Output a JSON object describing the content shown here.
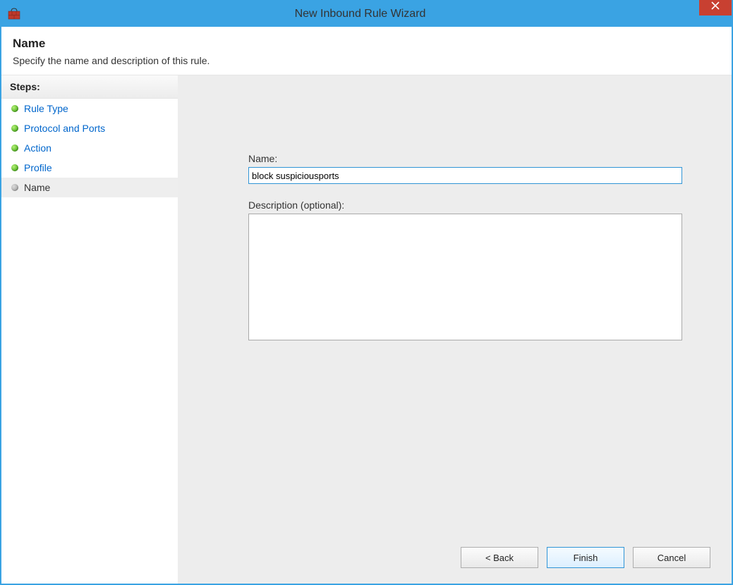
{
  "window": {
    "title": "New Inbound Rule Wizard",
    "close_glyph": "×"
  },
  "header": {
    "title": "Name",
    "subtitle": "Specify the name and description of this rule."
  },
  "sidebar": {
    "heading": "Steps:",
    "steps": [
      {
        "label": "Rule Type",
        "completed": true,
        "current": false
      },
      {
        "label": "Protocol and Ports",
        "completed": true,
        "current": false
      },
      {
        "label": "Action",
        "completed": true,
        "current": false
      },
      {
        "label": "Profile",
        "completed": true,
        "current": false
      },
      {
        "label": "Name",
        "completed": false,
        "current": true
      }
    ]
  },
  "form": {
    "name_label": "Name:",
    "name_value": "block suspiciousports",
    "description_label": "Description (optional):",
    "description_value": ""
  },
  "buttons": {
    "back": "< Back",
    "finish": "Finish",
    "cancel": "Cancel"
  }
}
